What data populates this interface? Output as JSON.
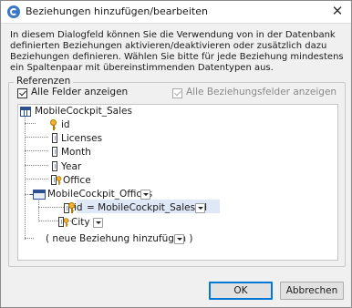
{
  "window": {
    "title": "Beziehungen hinzufügen/bearbeiten",
    "close_glyph": "✕"
  },
  "description": "In diesem Dialogfeld können Sie die Verwendung von in der Datenbank definierten Beziehungen aktivieren/deaktivieren oder zusätzlich dazu Beziehungen definieren. Wählen Sie bitte für jede Beziehung mindestens ein Spaltenpaar mit übereinstimmenden Datentypen aus.",
  "group": {
    "label": "Referenzen",
    "show_all_fields": {
      "label": "Alle Felder anzeigen",
      "checked": true
    },
    "show_all_relation_fields": {
      "label": "Alle Beziehungsfelder anzeigen",
      "checked": true,
      "enabled": false
    }
  },
  "tree": {
    "root_table": {
      "name": "MobileCockpit_Sales",
      "icon": "table-icon",
      "columns": [
        {
          "name": "id",
          "icon": "key-icon"
        },
        {
          "name": "Licenses",
          "icon": "column-icon"
        },
        {
          "name": "Month",
          "icon": "column-icon"
        },
        {
          "name": "Year",
          "icon": "column-icon"
        },
        {
          "name": "Office",
          "icon": "foreign-key-icon"
        }
      ]
    },
    "relation": {
      "table": "MobileCockpit_Offices",
      "icon": "relation-table-icon",
      "columns": [
        {
          "name": "id",
          "icon": "key-icon",
          "mapping": "= MobileCockpit_Sales.id",
          "selected": true
        },
        {
          "name": "City",
          "icon": "foreign-key-icon"
        }
      ]
    },
    "new_relation_label": "( neue Beziehung hinzufügen )"
  },
  "buttons": {
    "ok": "OK",
    "cancel": "Abbrechen"
  },
  "colors": {
    "accent": "#0078d7",
    "selection": "#dfe8f7",
    "window_bg": "#f0f0f0"
  }
}
